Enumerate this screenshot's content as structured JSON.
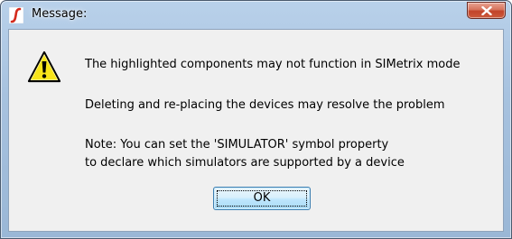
{
  "window": {
    "title": "Message:",
    "app_icon": "simetrix-logo-icon",
    "close_icon": "close-icon"
  },
  "dialog": {
    "icon": "warning-icon",
    "lines": [
      "The highlighted components may not function in SIMetrix mode",
      "Deleting and re-placing the devices may resolve the problem",
      "Note: You can set the 'SIMULATOR' symbol property",
      "to declare which simulators are supported by a device"
    ],
    "ok_label": "OK"
  },
  "colors": {
    "warning_yellow": "#f7e41a",
    "close_red": "#c2442a",
    "client_bg": "#f0f0f0"
  }
}
